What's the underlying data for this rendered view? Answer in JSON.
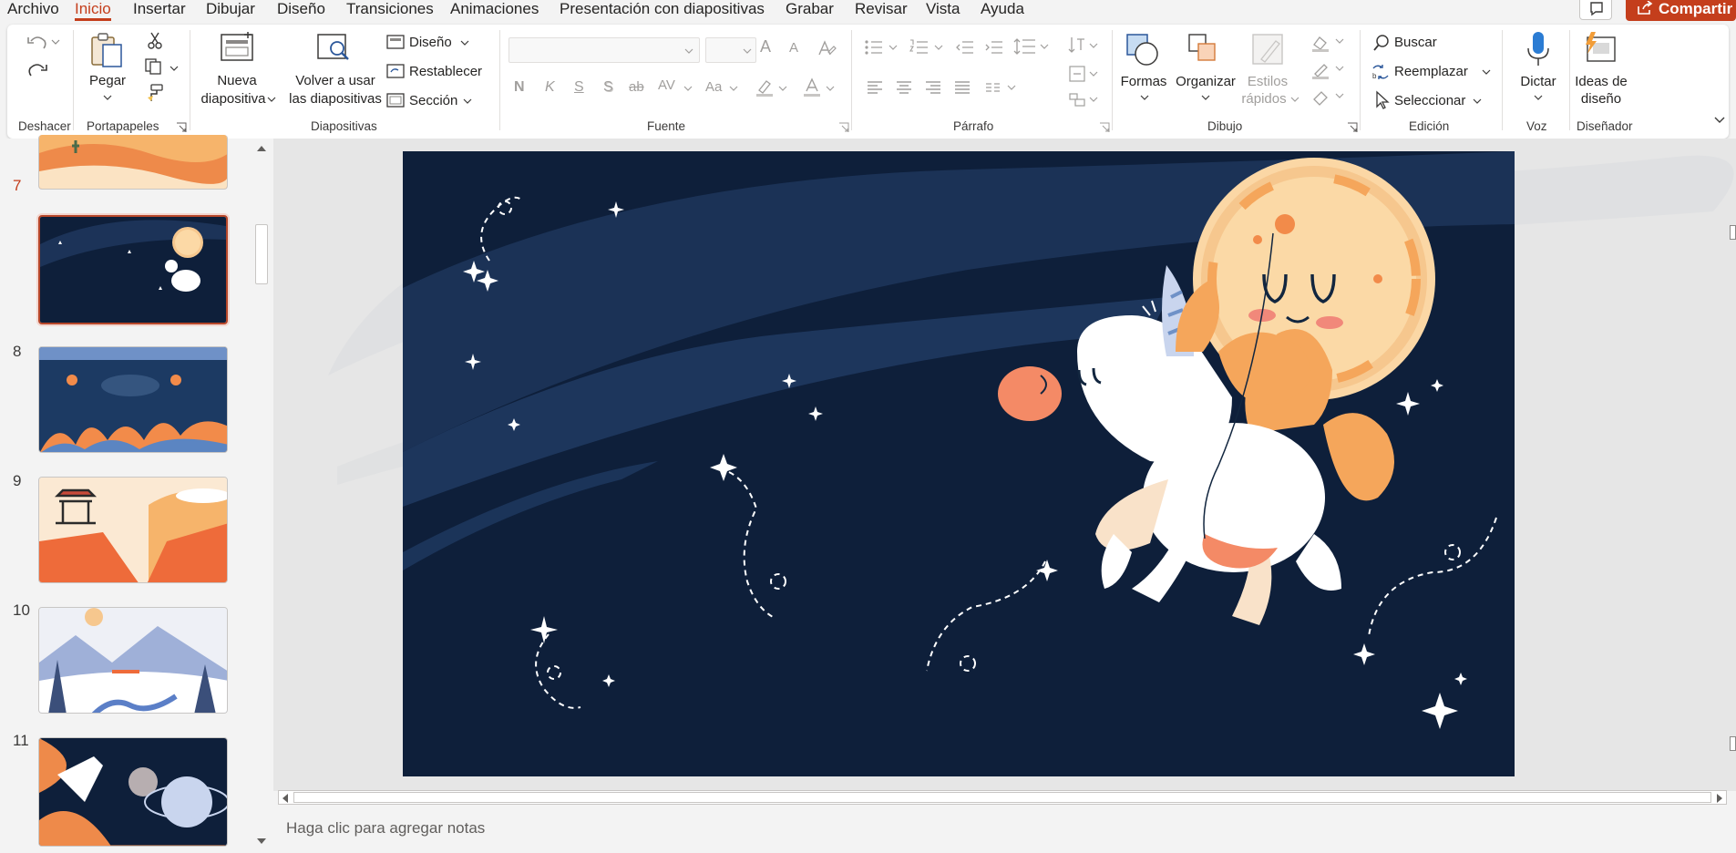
{
  "menu": {
    "tabs": [
      "Archivo",
      "Inicio",
      "Insertar",
      "Dibujar",
      "Diseño",
      "Transiciones",
      "Animaciones",
      "Presentación con diapositivas",
      "Grabar",
      "Revisar",
      "Vista",
      "Ayuda"
    ],
    "active_tab": "Inicio",
    "share_label": "Compartir"
  },
  "ribbon": {
    "groups": {
      "undo": "Deshacer",
      "clipboard": "Portapapeles",
      "slides": "Diapositivas",
      "font": "Fuente",
      "paragraph": "Párrafo",
      "drawing": "Dibujo",
      "editing": "Edición",
      "voice": "Voz",
      "designer": "Diseñador"
    },
    "paste_label": "Pegar",
    "new_slide_label_1": "Nueva",
    "new_slide_label_2": "diapositiva",
    "reuse_label_1": "Volver a usar",
    "reuse_label_2": "las diapositivas",
    "layout_label": "Diseño",
    "reset_label": "Restablecer",
    "section_label": "Sección",
    "shapes_label": "Formas",
    "arrange_label": "Organizar",
    "quick_styles_label_1": "Estilos",
    "quick_styles_label_2": "rápidos",
    "find_label": "Buscar",
    "replace_label": "Reemplazar",
    "select_label": "Seleccionar",
    "dictate_label": "Dictar",
    "design_ideas_label_1": "Ideas de",
    "design_ideas_label_2": "diseño",
    "font_bold": "N",
    "font_italic": "K",
    "font_underline": "S",
    "font_shadow": "S",
    "font_strike": "ab",
    "font_spacing": "AV",
    "font_case": "Aa",
    "font_grow": "A",
    "font_shrink": "A"
  },
  "thumbnails": [
    {
      "number": "7",
      "selected": true
    },
    {
      "number": "8",
      "selected": false
    },
    {
      "number": "9",
      "selected": false
    },
    {
      "number": "10",
      "selected": false
    },
    {
      "number": "11",
      "selected": false
    }
  ],
  "notes_placeholder": "Haga clic para agregar notas",
  "colors": {
    "accent": "#c43e1c",
    "slide_bg": "#0e1f3a",
    "moon": "#f6c78e",
    "unicorn_mane": "#f5a65b"
  }
}
